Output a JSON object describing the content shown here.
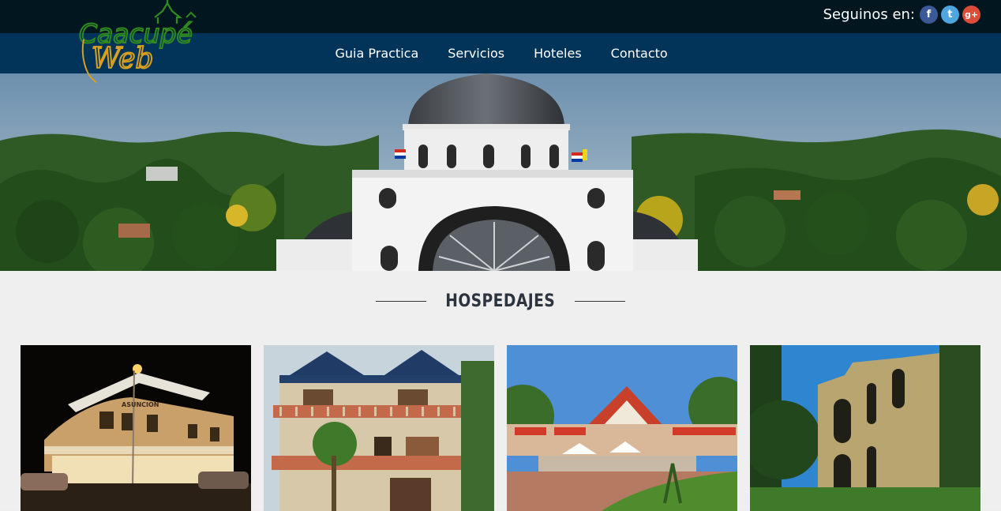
{
  "header": {
    "follow_label": "Seguinos en:",
    "social": [
      {
        "name": "facebook",
        "glyph": "f",
        "color": "#3b5998"
      },
      {
        "name": "twitter",
        "glyph": "t",
        "color": "#4ea6e0"
      },
      {
        "name": "google-plus",
        "glyph": "g+",
        "color": "#dd4b39"
      }
    ]
  },
  "logo": {
    "line1": "Caacupé",
    "line2": "Web"
  },
  "nav": {
    "items": [
      {
        "label": "Guia Practica"
      },
      {
        "label": "Servicios"
      },
      {
        "label": "Hoteles"
      },
      {
        "label": "Contacto"
      }
    ]
  },
  "section": {
    "title": "HOSPEDAJES"
  },
  "cards": [
    {
      "name": "hotel-asuncion"
    },
    {
      "name": "hotel-balconies"
    },
    {
      "name": "hotel-resort"
    },
    {
      "name": "stone-ruins"
    }
  ],
  "colors": {
    "topbar": "#02161f",
    "navbar": "#02345a",
    "section_bg": "#efefef",
    "logo_green": "#2f8a1f",
    "logo_gold": "#d8a020"
  }
}
